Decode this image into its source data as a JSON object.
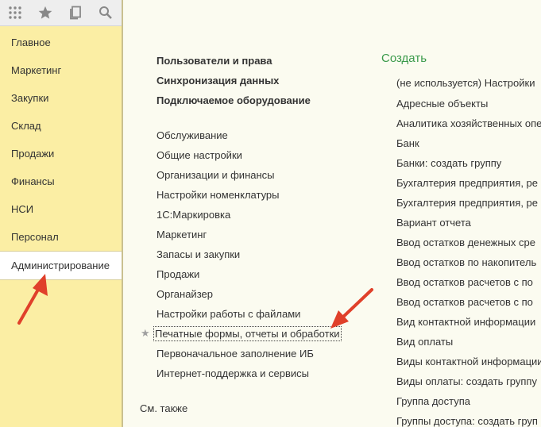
{
  "toolbar": {
    "icons": [
      "grid-icon",
      "star-icon",
      "history-icon",
      "search-icon"
    ]
  },
  "sidebar": {
    "items": [
      {
        "label": "Главное"
      },
      {
        "label": "Маркетинг"
      },
      {
        "label": "Закупки"
      },
      {
        "label": "Склад"
      },
      {
        "label": "Продажи"
      },
      {
        "label": "Финансы"
      },
      {
        "label": "НСИ"
      },
      {
        "label": "Персонал"
      },
      {
        "label": "Администрирование",
        "active": true
      }
    ]
  },
  "main": {
    "bold_links": [
      "Пользователи и права",
      "Синхронизация данных",
      "Подключаемое оборудование"
    ],
    "links": [
      "Обслуживание",
      "Общие настройки",
      "Организации и финансы",
      "Настройки номенклатуры",
      "1С:Маркировка",
      "Маркетинг",
      "Запасы и закупки",
      "Продажи",
      "Органайзер",
      "Настройки работы с файлами",
      "Печатные формы, отчеты и обработки",
      "Первоначальное заполнение ИБ",
      "Интернет-поддержка и сервисы"
    ],
    "favorite_index": 10,
    "see_also": "См. также"
  },
  "create": {
    "title": "Создать",
    "items": [
      "(не используется) Настройки",
      "Адресные объекты",
      "Аналитика хозяйственных опе",
      "Банк",
      "Банки: создать группу",
      "Бухгалтерия предприятия, ре",
      "Бухгалтерия предприятия, ре",
      "Вариант отчета",
      "Ввод остатков денежных сре",
      "Ввод остатков по накопитель",
      "Ввод остатков расчетов с по",
      "Ввод остатков расчетов с по",
      "Вид контактной информации",
      "Вид оплаты",
      "Виды контактной информации",
      "Виды оплаты: создать группу",
      "Группа доступа",
      "Группы доступа: создать груп"
    ]
  },
  "colors": {
    "sidebar_bg": "#fbeea4",
    "content_bg": "#fbfbf0",
    "accent_green": "#3a9a4a",
    "annotation_arrow": "#e0402a"
  }
}
